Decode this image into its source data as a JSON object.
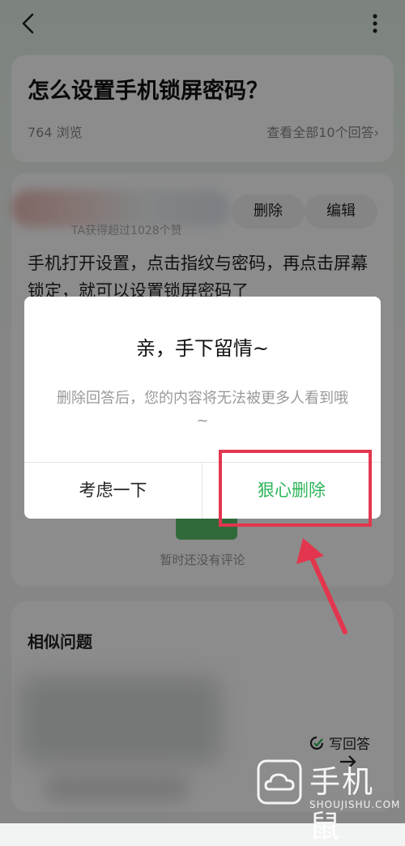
{
  "question": {
    "title": "怎么设置手机锁屏密码？",
    "views": "764 浏览",
    "view_all": "查看全部10个回答"
  },
  "answer": {
    "user_sub": "TA获得超过1028个赞",
    "delete_label": "删除",
    "edit_label": "编辑",
    "text": "手机打开设置，点击指纹与密码，再点击屏幕锁定，就可以设置锁屏密码了",
    "no_comment": "暂时还没有评论"
  },
  "similar": {
    "title": "相似问题",
    "write_answer": "写回答"
  },
  "dialog": {
    "title": "亲，手下留情~",
    "message": "删除回答后，您的内容将无法被更多人看到哦~",
    "cancel_label": "考虑一下",
    "confirm_label": "狠心删除"
  },
  "watermark": {
    "text": "手机鼠",
    "sub": "SHOUJISHU.COM"
  },
  "colors": {
    "accent_green": "#2fb55a",
    "highlight_red": "#e3364e"
  }
}
